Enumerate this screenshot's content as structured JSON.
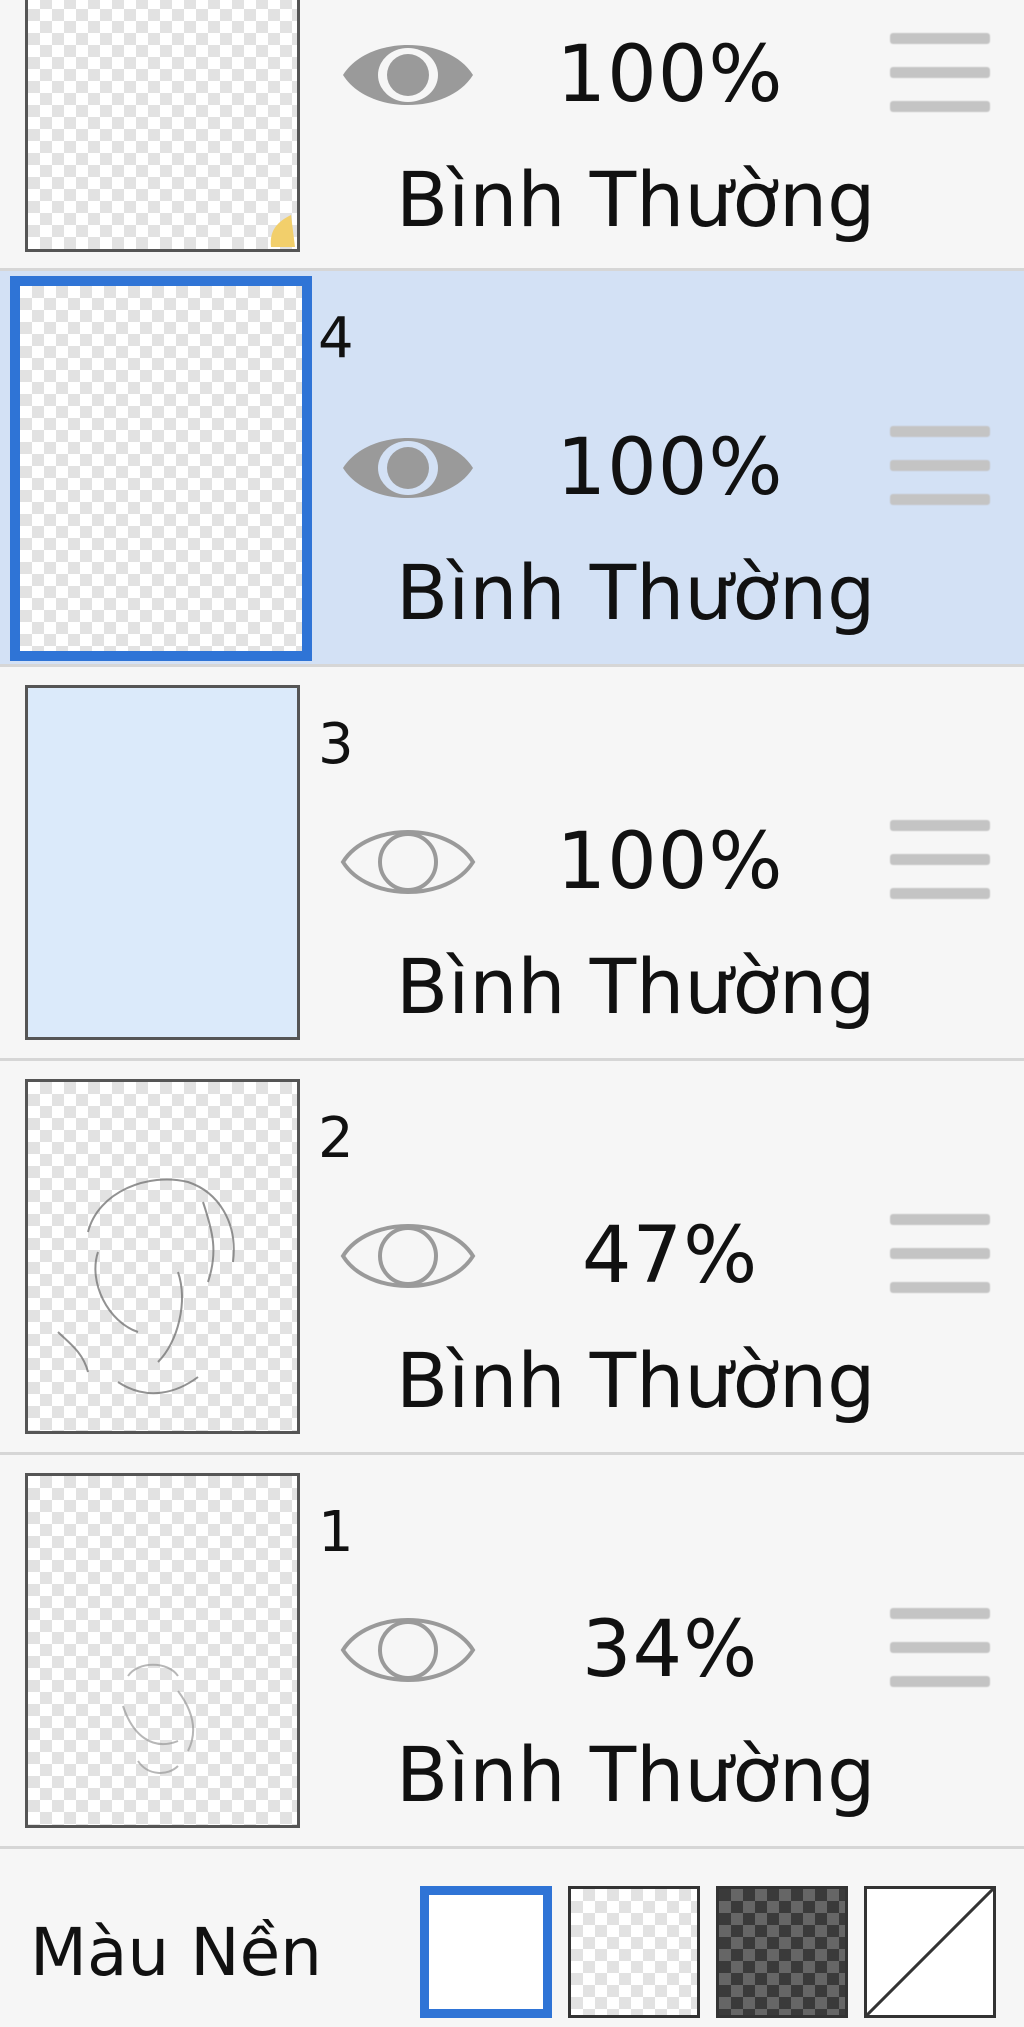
{
  "layers": [
    {
      "number": "",
      "opacity": "100%",
      "blend": "Bình Thường",
      "visible": true,
      "selected": false
    },
    {
      "number": "4",
      "opacity": "100%",
      "blend": "Bình Thường",
      "visible": true,
      "selected": true
    },
    {
      "number": "3",
      "opacity": "100%",
      "blend": "Bình Thường",
      "visible": false,
      "selected": false
    },
    {
      "number": "2",
      "opacity": "47%",
      "blend": "Bình Thường",
      "visible": false,
      "selected": false
    },
    {
      "number": "1",
      "opacity": "34%",
      "blend": "Bình Thường",
      "visible": false,
      "selected": false
    }
  ],
  "footer": {
    "label": "Màu Nền",
    "options": [
      "white",
      "transparent-light",
      "transparent-dark",
      "none"
    ],
    "selected": "white"
  },
  "colors": {
    "accent": "#2f74d6",
    "selected_row": "#d3e1f5",
    "row_bg": "#f6f6f6",
    "layer3_fill": "#dbeafa",
    "eye_visible": "#9a9a9a",
    "eye_hidden_stroke": "#9a9a9a"
  },
  "icons": {
    "visibility_on": "eye-filled-icon",
    "visibility_off": "eye-outline-icon",
    "reorder": "drag-handle-icon"
  }
}
